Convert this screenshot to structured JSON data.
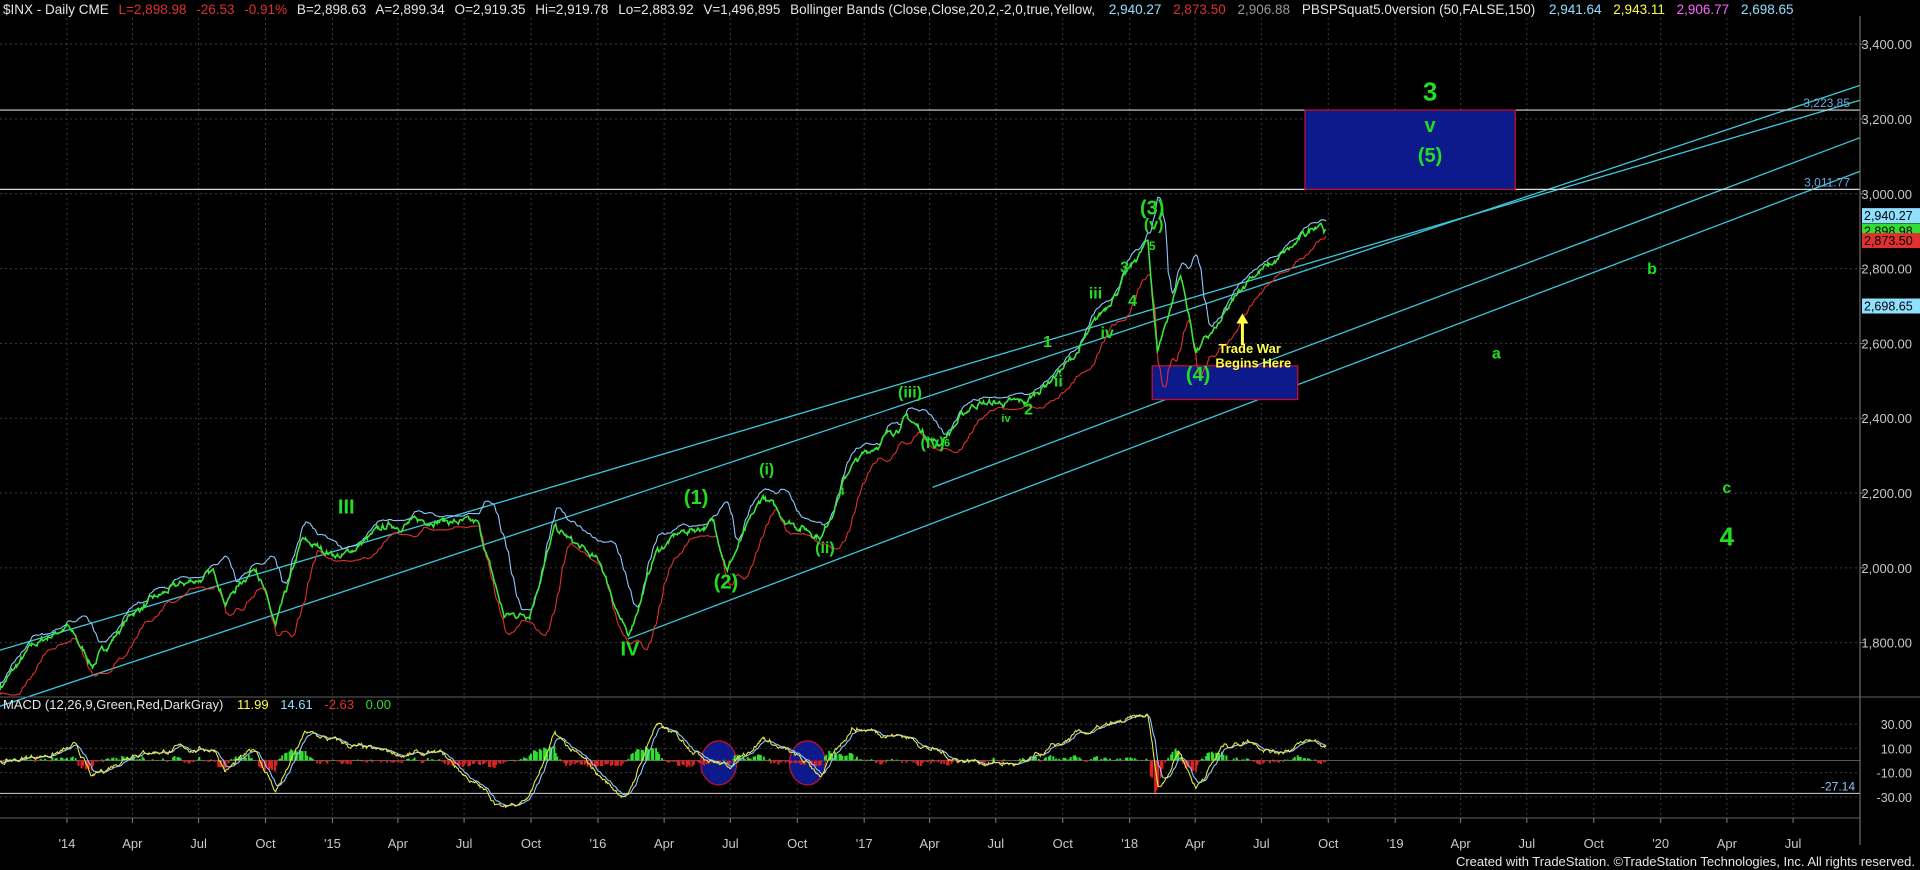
{
  "header": {
    "symbol": "$INX - Daily  CME",
    "last": "L=2,898.98",
    "change": "-26.53",
    "change_pct": "-0.91%",
    "bid": "B=2,898.63",
    "ask": "A=2,899.34",
    "open": "O=2,919.35",
    "high": "Hi=2,919.78",
    "low": "Lo=2,883.92",
    "volume": "V=1,496,895",
    "bb_label": "Bollinger Bands (Close,Close,20,2,-2,0,true,Yellow,",
    "bb_v1": "2,940.27",
    "bb_v2": "2,873.50",
    "bb_v3": "2,906.88",
    "pbs_label": "PBSPSquat5.0version (50,FALSE,150)",
    "pbs_v1": "2,941.64",
    "pbs_v2": "2,943.11",
    "pbs_v3": "2,906.77",
    "pbs_v4": "2,698.65"
  },
  "macd_header": {
    "label": "MACD (12,26,9,Green,Red,DarkGray)",
    "v1": "11.99",
    "v2": "14.61",
    "v3": "-2.63",
    "v4": "0.00"
  },
  "footer": {
    "credit": "Created with TradeStation. ©TradeStation Technologies, Inc. All rights reserved."
  },
  "colors": {
    "background": "#000000",
    "grid": "#3c3c3c",
    "price": "#39e639",
    "upper_band": "#8fc6ff",
    "lower_band": "#e03030",
    "channel": "#3ac8dc",
    "box_fill": "#0c1a8c",
    "box_border": "#c01030",
    "wave_label": "#22dd22",
    "annotation": "#ffff44",
    "axis_text": "#c8c8c8"
  },
  "chart_data": [
    {
      "type": "line",
      "title": "$INX - Daily CME",
      "x_ticks": [
        "'14",
        "Apr",
        "Jul",
        "Oct",
        "'15",
        "Apr",
        "Jul",
        "Oct",
        "'16",
        "Apr",
        "Jul",
        "Oct",
        "'17",
        "Apr",
        "Jul",
        "Oct",
        "'18",
        "Apr",
        "Jul",
        "Oct",
        "'19",
        "Apr",
        "Jul",
        "Oct",
        "'20",
        "Apr",
        "Jul"
      ],
      "x_range": [
        "2013-10-01",
        "2020-10-01"
      ],
      "y_ticks": [
        "1,800.00",
        "2,000.00",
        "2,200.00",
        "2,400.00",
        "2,600.00",
        "2,800.00",
        "3,000.00",
        "3,200.00",
        "3,400.00"
      ],
      "ylim": [
        1660,
        3470
      ],
      "series": [
        {
          "x": [
            "2013-10-01",
            "2013-11-15",
            "2014-01-01",
            "2014-02-05",
            "2014-04-01",
            "2014-06-01",
            "2014-07-24",
            "2014-08-07",
            "2014-09-18",
            "2014-10-15",
            "2014-11-20",
            "2015-01-15",
            "2015-03-15",
            "2015-05-20",
            "2015-07-20",
            "2015-08-25",
            "2015-09-29",
            "2015-11-03",
            "2016-01-05",
            "2016-02-11",
            "2016-03-20",
            "2016-04-20",
            "2016-06-08",
            "2016-06-27",
            "2016-08-15",
            "2016-09-15",
            "2016-11-04",
            "2016-12-13",
            "2017-03-01",
            "2017-04-13",
            "2017-06-01",
            "2017-08-10",
            "2017-10-15",
            "2018-01-26",
            "2018-02-08",
            "2018-03-12",
            "2018-04-02",
            "2018-05-01",
            "2018-06-15",
            "2018-07-15",
            "2018-08-15",
            "2018-09-20",
            "2018-09-28"
          ],
          "y": [
            1680,
            1790,
            1845,
            1740,
            1880,
            1950,
            1985,
            1910,
            2010,
            1840,
            2070,
            2030,
            2110,
            2130,
            2115,
            1870,
            1880,
            2105,
            2010,
            1810,
            2040,
            2090,
            2120,
            2000,
            2190,
            2130,
            2085,
            2270,
            2400,
            2330,
            2440,
            2440,
            2560,
            2872,
            2580,
            2786,
            2580,
            2640,
            2780,
            2810,
            2860,
            2930,
            2899
          ]
        }
      ],
      "horizontal_lines": [
        {
          "value": 3223.85,
          "label": "3,223.85"
        },
        {
          "value": 3011.77,
          "label": "3,011.77"
        }
      ],
      "channels": [
        {
          "from": [
            "2013-10-01",
            1780
          ],
          "to": [
            "2020-10-01",
            3250
          ]
        },
        {
          "from": [
            "2013-10-01",
            1630
          ],
          "to": [
            "2020-10-01",
            3290
          ]
        },
        {
          "from": [
            "2017-04-05",
            2215
          ],
          "to": [
            "2020-10-01",
            3150
          ]
        },
        {
          "from": [
            "2016-02-11",
            1810
          ],
          "to": [
            "2020-10-01",
            3060
          ]
        }
      ],
      "boxes": [
        {
          "x0": "2018-08-30",
          "x1": "2019-06-15",
          "y0": 3011.77,
          "y1": 3223.85
        },
        {
          "x0": "2018-02-01",
          "x1": "2018-08-20",
          "y0": 2450,
          "y1": 2540
        }
      ],
      "price_labels": [
        {
          "text": "2,940.27",
          "color": "#8fe0ff"
        },
        {
          "text": "2,898.98",
          "color": "#30dd30"
        },
        {
          "text": "2,873.50",
          "color": "#e03030"
        },
        {
          "text": "2,698.65",
          "color": "#8fe0ff"
        }
      ],
      "wave_labels": [
        {
          "text": "III",
          "x": "2015-01-20",
          "y": 2145,
          "size": "l"
        },
        {
          "text": "IV",
          "x": "2016-02-14",
          "y": 1765,
          "size": "l"
        },
        {
          "text": "(1)",
          "x": "2016-05-15",
          "y": 2170,
          "size": "l"
        },
        {
          "text": "(2)",
          "x": "2016-06-25",
          "y": 1945,
          "size": "l"
        },
        {
          "text": "(i)",
          "x": "2016-08-20",
          "y": 2250,
          "size": "m"
        },
        {
          "text": "(ii)",
          "x": "2016-11-08",
          "y": 2040,
          "size": "m"
        },
        {
          "text": "(iii)",
          "x": "2017-03-05",
          "y": 2455,
          "size": "m"
        },
        {
          "text": "(iv)",
          "x": "2017-04-05",
          "y": 2320,
          "size": "m"
        },
        {
          "text": "1",
          "x": "2017-09-10",
          "y": 2590,
          "size": "m"
        },
        {
          "text": "2",
          "x": "2017-08-15",
          "y": 2410,
          "size": "m"
        },
        {
          "text": "ii",
          "x": "2017-09-25",
          "y": 2485,
          "size": "m"
        },
        {
          "text": "iii",
          "x": "2017-11-15",
          "y": 2720,
          "size": "m"
        },
        {
          "text": "3",
          "x": "2017-12-25",
          "y": 2790,
          "size": "m"
        },
        {
          "text": "4",
          "x": "2018-01-05",
          "y": 2700,
          "size": "m"
        },
        {
          "text": "iv",
          "x": "2017-12-01",
          "y": 2615,
          "size": "m"
        },
        {
          "text": "5",
          "x": "2018-02-01",
          "y": 2850,
          "size": "s"
        },
        {
          "text": "(v)",
          "x": "2018-02-03",
          "y": 2905,
          "size": "m"
        },
        {
          "text": "(3)",
          "x": "2018-02-01",
          "y": 2945,
          "size": "l"
        },
        {
          "text": "(4)",
          "x": "2018-04-05",
          "y": 2500,
          "size": "l"
        },
        {
          "text": "3",
          "x": "2019-02-18",
          "y": 3250,
          "size": "xl"
        },
        {
          "text": "v",
          "x": "2019-02-18",
          "y": 3165,
          "size": "l"
        },
        {
          "text": "(5)",
          "x": "2019-02-18",
          "y": 3085,
          "size": "l"
        },
        {
          "text": "b",
          "x": "2019-12-20",
          "y": 2785,
          "size": "m"
        },
        {
          "text": "a",
          "x": "2019-05-20",
          "y": 2560,
          "size": "m"
        },
        {
          "text": "c",
          "x": "2020-04-01",
          "y": 2200,
          "size": "m"
        },
        {
          "text": "4",
          "x": "2020-04-01",
          "y": 2060,
          "size": "xl"
        }
      ],
      "small_labels": [
        {
          "text": "4",
          "x": "2016-12-01",
          "y": 2195
        },
        {
          "text": "iv",
          "x": "2017-07-15",
          "y": 2390
        },
        {
          "text": "6",
          "x": "2017-04-25",
          "y": 2325
        }
      ],
      "annotations": [
        {
          "text": "Trade War",
          "x": "2018-06-15",
          "y": 2575
        },
        {
          "text": "Begins Here",
          "x": "2018-06-20",
          "y": 2535
        }
      ],
      "arrow": {
        "x": "2018-06-05",
        "from": 2595,
        "to": 2680
      }
    },
    {
      "type": "line",
      "title": "MACD (12,26,9,Green,Red,DarkGray)",
      "y_ticks": [
        "30.00",
        "10.00",
        "-10.00",
        "-30.00"
      ],
      "ylim": [
        -45,
        50
      ],
      "series": [
        {
          "name": "MACD",
          "x": [
            "2013-10-01",
            "2014-01-15",
            "2014-02-05",
            "2014-04-01",
            "2014-07-24",
            "2014-08-07",
            "2014-09-18",
            "2014-10-15",
            "2014-11-25",
            "2015-03-01",
            "2015-06-01",
            "2015-08-25",
            "2015-09-29",
            "2015-11-03",
            "2016-01-20",
            "2016-02-11",
            "2016-03-20",
            "2016-04-20",
            "2016-06-27",
            "2016-08-15",
            "2016-11-04",
            "2016-12-15",
            "2017-03-01",
            "2017-05-01",
            "2017-08-10",
            "2017-10-20",
            "2018-01-26",
            "2018-02-10",
            "2018-03-10",
            "2018-04-02",
            "2018-05-10",
            "2018-06-15",
            "2018-07-20",
            "2018-09-10",
            "2018-09-28"
          ],
          "y": [
            -2,
            10,
            -16,
            8,
            10,
            -8,
            8,
            -25,
            22,
            6,
            4,
            -40,
            -28,
            20,
            -22,
            -30,
            30,
            18,
            -5,
            20,
            -12,
            28,
            20,
            2,
            -4,
            20,
            36,
            -25,
            10,
            -22,
            12,
            18,
            8,
            16,
            12
          ]
        }
      ],
      "reference_lines": [
        {
          "value": -27.14,
          "label": "-27.14"
        }
      ],
      "highlight_ellipses": [
        {
          "x": "2016-06-15"
        },
        {
          "x": "2016-10-15"
        }
      ]
    }
  ]
}
